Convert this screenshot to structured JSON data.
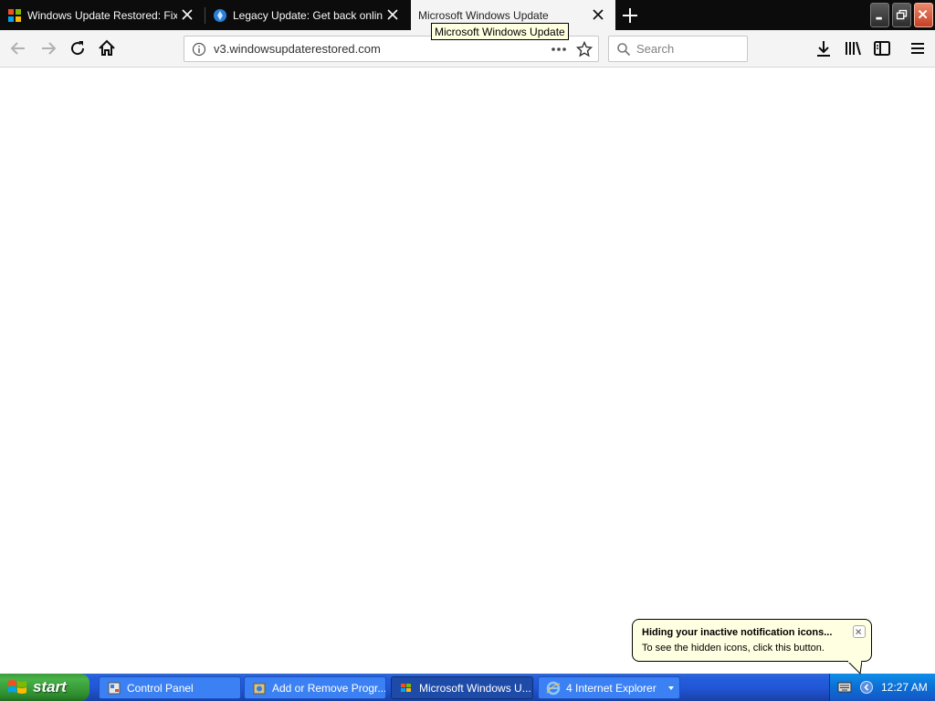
{
  "browser": {
    "tabs": [
      {
        "title": "Windows Update Restored: Fix Windows Update",
        "active": false
      },
      {
        "title": "Legacy Update: Get back online, and update Windows",
        "active": false
      },
      {
        "title": "Microsoft Windows Update",
        "active": true
      }
    ],
    "tooltip": "Microsoft Windows Update",
    "url": "v3.windowsupdaterestored.com",
    "search_placeholder": "Search"
  },
  "notification": {
    "title": "Hiding your inactive notification icons...",
    "text": "To see the hidden icons, click this button."
  },
  "taskbar": {
    "start_label": "start",
    "items": [
      {
        "label": "Control Panel",
        "icon": "control-panel-icon"
      },
      {
        "label": "Add or Remove Progr...",
        "icon": "add-remove-programs-icon"
      },
      {
        "label": "Microsoft Windows U...",
        "icon": "windows-update-icon",
        "active": true
      },
      {
        "label": "4 Internet Explorer",
        "icon": "internet-explorer-icon"
      }
    ],
    "clock": "12:27 AM"
  }
}
